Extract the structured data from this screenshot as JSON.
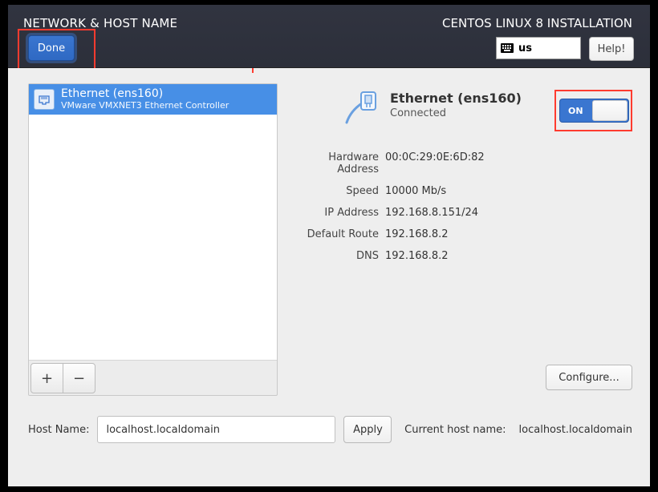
{
  "header": {
    "title": "NETWORK & HOST NAME",
    "install_title": "CENTOS LINUX 8 INSTALLATION",
    "done_label": "Done",
    "help_label": "Help!",
    "keyboard_layout": "us"
  },
  "interface_list": {
    "items": [
      {
        "name": "Ethernet (ens160)",
        "sub": "VMware VMXNET3 Ethernet Controller"
      }
    ],
    "add_label": "+",
    "remove_label": "−"
  },
  "connection": {
    "title": "Ethernet (ens160)",
    "status": "Connected",
    "toggle_state": "ON",
    "properties": {
      "hardware_address": {
        "label": "Hardware Address",
        "value": "00:0C:29:0E:6D:82"
      },
      "speed": {
        "label": "Speed",
        "value": "10000 Mb/s"
      },
      "ip_address": {
        "label": "IP Address",
        "value": "192.168.8.151/24"
      },
      "default_route": {
        "label": "Default Route",
        "value": "192.168.8.2"
      },
      "dns": {
        "label": "DNS",
        "value": "192.168.8.2"
      }
    },
    "configure_label": "Configure..."
  },
  "hostname": {
    "label": "Host Name:",
    "value": "localhost.localdomain",
    "apply_label": "Apply",
    "current_label": "Current host name:",
    "current_value": "localhost.localdomain"
  }
}
